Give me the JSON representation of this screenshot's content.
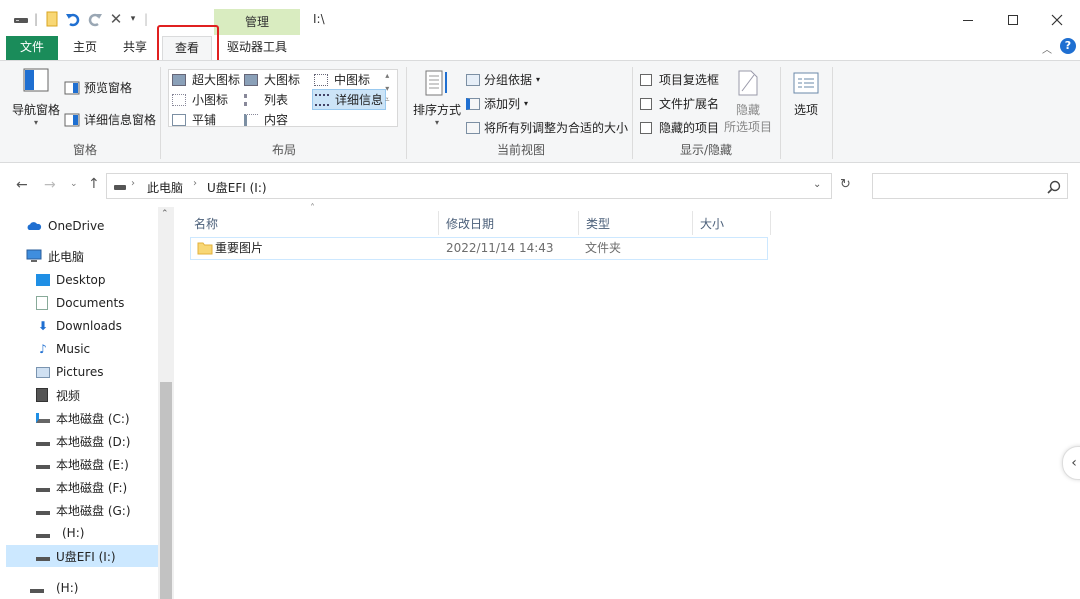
{
  "titlebar": {
    "context_tab": "管理",
    "path": "I:\\"
  },
  "tabs": {
    "file": "文件",
    "home": "主页",
    "share": "共享",
    "view": "查看",
    "drive_tools": "驱动器工具"
  },
  "ribbon": {
    "panes": {
      "nav_pane": "导航窗格",
      "preview_pane": "预览窗格",
      "details_pane": "详细信息窗格",
      "label": "窗格"
    },
    "layout": {
      "extra_large": "超大图标",
      "large": "大图标",
      "medium": "中图标",
      "small": "小图标",
      "list": "列表",
      "details": "详细信息",
      "tiles": "平铺",
      "content": "内容",
      "label": "布局"
    },
    "current_view": {
      "sort_by": "排序方式",
      "group_by": "分组依据",
      "add_columns": "添加列",
      "size_all": "将所有列调整为合适的大小",
      "label": "当前视图"
    },
    "show_hide": {
      "item_checkboxes": "项目复选框",
      "file_ext": "文件扩展名",
      "hidden_items": "隐藏的项目",
      "hide_selected_line1": "隐藏",
      "hide_selected_line2": "所选项目",
      "label": "显示/隐藏"
    },
    "options": "选项"
  },
  "address": {
    "segments": [
      "此电脑",
      "U盘EFI (I:)"
    ]
  },
  "nav": {
    "items": [
      {
        "label": "OneDrive"
      },
      {
        "label": "此电脑"
      },
      {
        "label": "Desktop"
      },
      {
        "label": "Documents"
      },
      {
        "label": "Downloads"
      },
      {
        "label": "Music"
      },
      {
        "label": "Pictures"
      },
      {
        "label": "视频"
      },
      {
        "label": "本地磁盘 (C:)"
      },
      {
        "label": "本地磁盘 (D:)"
      },
      {
        "label": "本地磁盘 (E:)"
      },
      {
        "label": "本地磁盘 (F:)"
      },
      {
        "label": "本地磁盘 (G:)"
      },
      {
        "label": "(H:)"
      },
      {
        "label": "U盘EFI (I:)"
      },
      {
        "label": "(H:)"
      }
    ]
  },
  "files": {
    "columns": [
      "名称",
      "修改日期",
      "类型",
      "大小"
    ],
    "rows": [
      {
        "name": "重要图片",
        "modified": "2022/11/14 14:43",
        "type": "文件夹",
        "size": ""
      }
    ]
  },
  "colors": {
    "file_tab": "#1a8c5a",
    "context_tab": "#d9ecc0",
    "highlight": "#e02020",
    "selection": "#cce8ff"
  }
}
